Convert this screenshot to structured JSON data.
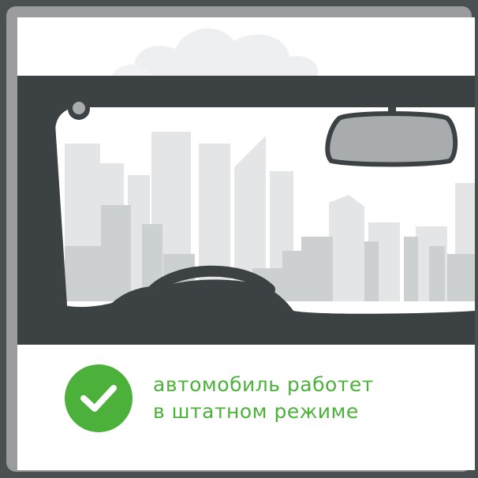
{
  "status": {
    "icon": "checkmark-circle-icon",
    "color": "#4cb13a",
    "line1": "автомобиль работет",
    "line2": "в штатном режиме"
  },
  "illustration": {
    "frame_color": "#3c4144",
    "skyline_colors": [
      "#e4e5e6",
      "#cdd0d1"
    ],
    "icons": [
      "windshield-frame-icon",
      "rearview-mirror-icon",
      "steering-wheel-icon",
      "city-skyline-icon"
    ]
  }
}
